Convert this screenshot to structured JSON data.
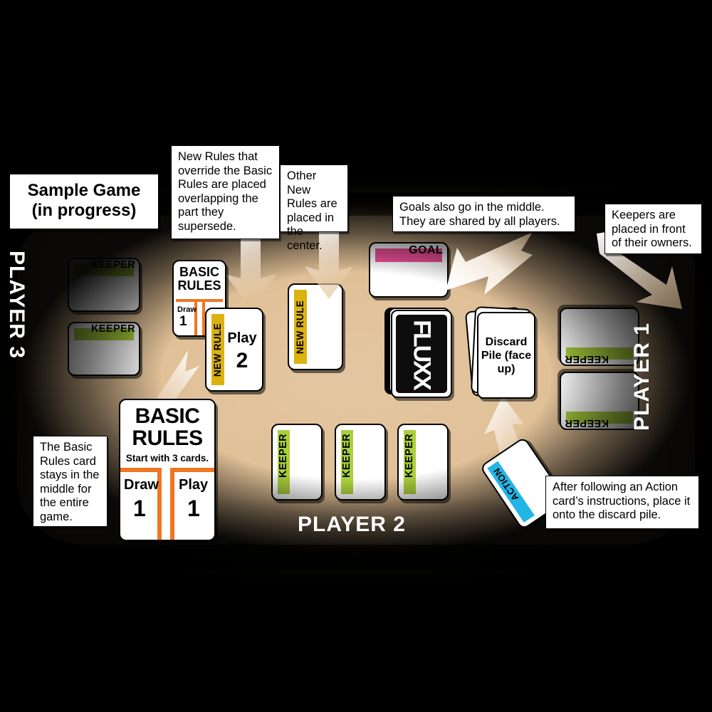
{
  "title_box": {
    "line1": "Sample Game",
    "line2": "(in progress)"
  },
  "colors": {
    "table": "#e0bf95",
    "keeper_bar": "#a9cf3d",
    "goal_bar": "#f0509a",
    "new_rule_bar": "#dbb210",
    "action_bar": "#22b5e6",
    "basic_rules_rail": "#ef7622",
    "background": "#000000",
    "card_face": "#ffffff"
  },
  "callouts": [
    {
      "id": "new-rules-override",
      "text": "New Rules that override the Basic Rules are placed overlapping the part they supersede."
    },
    {
      "id": "other-new-rules",
      "text": "Other New Rules are placed in the center."
    },
    {
      "id": "goals-middle",
      "text": "Goals also go in the middle. They are shared by all players."
    },
    {
      "id": "keepers-in-front",
      "text": "Keepers are placed in front of their owners."
    },
    {
      "id": "basic-rules-stays",
      "text": "The Basic Rules card stays in the middle for the entire game."
    },
    {
      "id": "action-discard",
      "text": "After following an Action card’s instructions, place it onto the discard pile."
    }
  ],
  "players": {
    "player1": "PLAYER 1",
    "player2": "PLAYER 2",
    "player3": "PLAYER 3"
  },
  "cards": {
    "keeper_label": "KEEPER",
    "goal_label": "GOAL",
    "new_rule_label": "NEW RULE",
    "action_label": "ACTION",
    "deck_logo": "FLUXX",
    "discard_label": "Discard Pile (face up)",
    "basic_rules": {
      "title_line1": "BASIC",
      "title_line2": "RULES",
      "subtitle": "Start with 3 cards.",
      "draw_label": "Draw",
      "draw_value": "1",
      "play_label": "Play",
      "play_value": "1"
    },
    "basic_rules_small": {
      "title_line1": "BASIC",
      "title_line2": "RULES",
      "draw_label": "Draw",
      "draw_value": "1"
    },
    "new_rule_play": {
      "word": "Play",
      "value": "2"
    }
  },
  "counts": {
    "player1_keepers": 2,
    "player2_keepers": 3,
    "player3_keepers": 2,
    "goals": 1,
    "new_rules": 2
  }
}
